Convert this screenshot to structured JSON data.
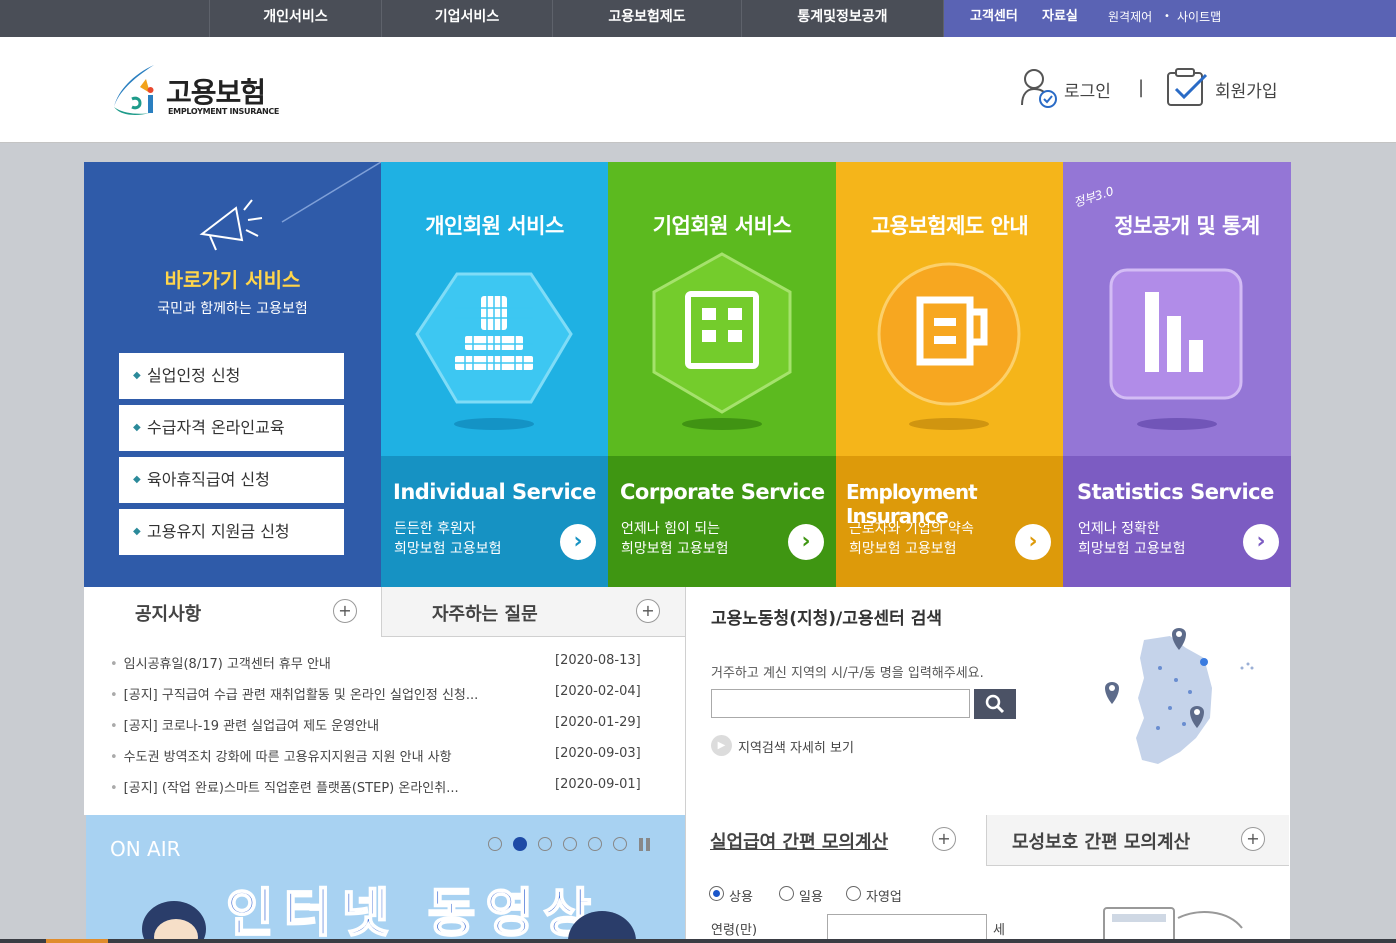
{
  "topnav": {
    "items": [
      "개인서비스",
      "기업서비스",
      "고용보험제도",
      "통계및정보공개"
    ],
    "util": [
      "고객센터",
      "자료실",
      "원격제어",
      "사이트맵"
    ]
  },
  "header": {
    "logo_title": "고용보험",
    "logo_sub": "EMPLOYMENT INSURANCE",
    "login": "로그인",
    "signup": "회원가입",
    "divider": "|"
  },
  "quick": {
    "title": "바로가기 서비스",
    "subtitle": "국민과 함께하는 고용보험",
    "buttons": [
      "실업인정 신청",
      "수급자격 온라인교육",
      "육아휴직급여 신청",
      "고용유지 지원금 신청"
    ]
  },
  "cards": [
    {
      "title": "개인회원 서비스",
      "eng": "Individual Service",
      "line1": "든든한 후원자",
      "line2": "희망보험 고용보험",
      "color": "#1fb1e3",
      "band": "#1692c3"
    },
    {
      "title": "기업회원 서비스",
      "eng": "Corporate Service",
      "line1": "언제나 힘이 되는",
      "line2": "희망보험 고용보험",
      "color": "#5cba1f",
      "band": "#3f9612"
    },
    {
      "title": "고용보험제도 안내",
      "eng": "Employment Insurance",
      "line1": "근로자와 기업의 약속",
      "line2": "희망보험 고용보험",
      "color": "#f5b51a",
      "band": "#dd9a0a"
    },
    {
      "title": "정보공개 및 통계",
      "eng": "Statistics Service",
      "line1": "언제나 정확한",
      "line2": "희망보험 고용보험",
      "color": "#9476d6",
      "band": "#7c5cc2",
      "badge": "정부3.0"
    }
  ],
  "notice": {
    "tab1": "공지사항",
    "tab2": "자주하는 질문",
    "items": [
      {
        "text": "임시공휴일(8/17) 고객센터 휴무 안내",
        "date": "[2020-08-13]"
      },
      {
        "text": "[공지] 구직급여 수급 관련 재취업활동 및 온라인 실업인정 신청...",
        "date": "[2020-02-04]"
      },
      {
        "text": "[공지] 코로나-19 관련 실업급여 제도 운영안내",
        "date": "[2020-01-29]"
      },
      {
        "text": "수도권 방역조치 강화에 따른 고용유지지원금 지원 안내 사항",
        "date": "[2020-09-03]"
      },
      {
        "text": "[공지] (작업 완료)스마트 직업훈련 플랫폼(STEP) 온라인취...",
        "date": "[2020-09-01]"
      }
    ]
  },
  "search": {
    "title": "고용노동청(지청)/고용센터 검색",
    "hint": "거주하고 계신 지역의 시/구/동 명을 입력해주세요.",
    "input_value": "",
    "detail": "지역검색 자세히 보기"
  },
  "onair": {
    "label": "ON AIR",
    "headline": "인터넷 동영상",
    "slide_count": 6,
    "active_slide": 2
  },
  "calc": {
    "tab1": "실업급여 간편 모의계산",
    "tab2": "모성보호 간편 모의계산",
    "radios": [
      "상용",
      "일용",
      "자영업"
    ],
    "selected": "상용",
    "age_label": "연령(만)",
    "age_value": "",
    "age_unit": "세"
  },
  "colors": {
    "topnav": "#4a4e57",
    "util": "#5a63b4",
    "quick": "#2f5ba9"
  }
}
